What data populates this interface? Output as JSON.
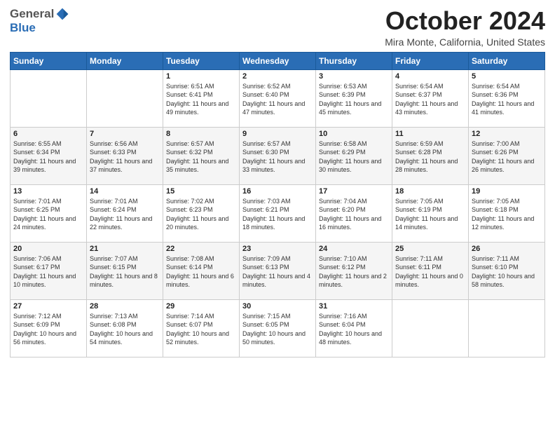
{
  "logo": {
    "general": "General",
    "blue": "Blue"
  },
  "header": {
    "month": "October 2024",
    "location": "Mira Monte, California, United States"
  },
  "weekdays": [
    "Sunday",
    "Monday",
    "Tuesday",
    "Wednesday",
    "Thursday",
    "Friday",
    "Saturday"
  ],
  "weeks": [
    [
      {
        "day": "",
        "sunrise": "",
        "sunset": "",
        "daylight": ""
      },
      {
        "day": "",
        "sunrise": "",
        "sunset": "",
        "daylight": ""
      },
      {
        "day": "1",
        "sunrise": "Sunrise: 6:51 AM",
        "sunset": "Sunset: 6:41 PM",
        "daylight": "Daylight: 11 hours and 49 minutes."
      },
      {
        "day": "2",
        "sunrise": "Sunrise: 6:52 AM",
        "sunset": "Sunset: 6:40 PM",
        "daylight": "Daylight: 11 hours and 47 minutes."
      },
      {
        "day": "3",
        "sunrise": "Sunrise: 6:53 AM",
        "sunset": "Sunset: 6:39 PM",
        "daylight": "Daylight: 11 hours and 45 minutes."
      },
      {
        "day": "4",
        "sunrise": "Sunrise: 6:54 AM",
        "sunset": "Sunset: 6:37 PM",
        "daylight": "Daylight: 11 hours and 43 minutes."
      },
      {
        "day": "5",
        "sunrise": "Sunrise: 6:54 AM",
        "sunset": "Sunset: 6:36 PM",
        "daylight": "Daylight: 11 hours and 41 minutes."
      }
    ],
    [
      {
        "day": "6",
        "sunrise": "Sunrise: 6:55 AM",
        "sunset": "Sunset: 6:34 PM",
        "daylight": "Daylight: 11 hours and 39 minutes."
      },
      {
        "day": "7",
        "sunrise": "Sunrise: 6:56 AM",
        "sunset": "Sunset: 6:33 PM",
        "daylight": "Daylight: 11 hours and 37 minutes."
      },
      {
        "day": "8",
        "sunrise": "Sunrise: 6:57 AM",
        "sunset": "Sunset: 6:32 PM",
        "daylight": "Daylight: 11 hours and 35 minutes."
      },
      {
        "day": "9",
        "sunrise": "Sunrise: 6:57 AM",
        "sunset": "Sunset: 6:30 PM",
        "daylight": "Daylight: 11 hours and 33 minutes."
      },
      {
        "day": "10",
        "sunrise": "Sunrise: 6:58 AM",
        "sunset": "Sunset: 6:29 PM",
        "daylight": "Daylight: 11 hours and 30 minutes."
      },
      {
        "day": "11",
        "sunrise": "Sunrise: 6:59 AM",
        "sunset": "Sunset: 6:28 PM",
        "daylight": "Daylight: 11 hours and 28 minutes."
      },
      {
        "day": "12",
        "sunrise": "Sunrise: 7:00 AM",
        "sunset": "Sunset: 6:26 PM",
        "daylight": "Daylight: 11 hours and 26 minutes."
      }
    ],
    [
      {
        "day": "13",
        "sunrise": "Sunrise: 7:01 AM",
        "sunset": "Sunset: 6:25 PM",
        "daylight": "Daylight: 11 hours and 24 minutes."
      },
      {
        "day": "14",
        "sunrise": "Sunrise: 7:01 AM",
        "sunset": "Sunset: 6:24 PM",
        "daylight": "Daylight: 11 hours and 22 minutes."
      },
      {
        "day": "15",
        "sunrise": "Sunrise: 7:02 AM",
        "sunset": "Sunset: 6:23 PM",
        "daylight": "Daylight: 11 hours and 20 minutes."
      },
      {
        "day": "16",
        "sunrise": "Sunrise: 7:03 AM",
        "sunset": "Sunset: 6:21 PM",
        "daylight": "Daylight: 11 hours and 18 minutes."
      },
      {
        "day": "17",
        "sunrise": "Sunrise: 7:04 AM",
        "sunset": "Sunset: 6:20 PM",
        "daylight": "Daylight: 11 hours and 16 minutes."
      },
      {
        "day": "18",
        "sunrise": "Sunrise: 7:05 AM",
        "sunset": "Sunset: 6:19 PM",
        "daylight": "Daylight: 11 hours and 14 minutes."
      },
      {
        "day": "19",
        "sunrise": "Sunrise: 7:05 AM",
        "sunset": "Sunset: 6:18 PM",
        "daylight": "Daylight: 11 hours and 12 minutes."
      }
    ],
    [
      {
        "day": "20",
        "sunrise": "Sunrise: 7:06 AM",
        "sunset": "Sunset: 6:17 PM",
        "daylight": "Daylight: 11 hours and 10 minutes."
      },
      {
        "day": "21",
        "sunrise": "Sunrise: 7:07 AM",
        "sunset": "Sunset: 6:15 PM",
        "daylight": "Daylight: 11 hours and 8 minutes."
      },
      {
        "day": "22",
        "sunrise": "Sunrise: 7:08 AM",
        "sunset": "Sunset: 6:14 PM",
        "daylight": "Daylight: 11 hours and 6 minutes."
      },
      {
        "day": "23",
        "sunrise": "Sunrise: 7:09 AM",
        "sunset": "Sunset: 6:13 PM",
        "daylight": "Daylight: 11 hours and 4 minutes."
      },
      {
        "day": "24",
        "sunrise": "Sunrise: 7:10 AM",
        "sunset": "Sunset: 6:12 PM",
        "daylight": "Daylight: 11 hours and 2 minutes."
      },
      {
        "day": "25",
        "sunrise": "Sunrise: 7:11 AM",
        "sunset": "Sunset: 6:11 PM",
        "daylight": "Daylight: 11 hours and 0 minutes."
      },
      {
        "day": "26",
        "sunrise": "Sunrise: 7:11 AM",
        "sunset": "Sunset: 6:10 PM",
        "daylight": "Daylight: 10 hours and 58 minutes."
      }
    ],
    [
      {
        "day": "27",
        "sunrise": "Sunrise: 7:12 AM",
        "sunset": "Sunset: 6:09 PM",
        "daylight": "Daylight: 10 hours and 56 minutes."
      },
      {
        "day": "28",
        "sunrise": "Sunrise: 7:13 AM",
        "sunset": "Sunset: 6:08 PM",
        "daylight": "Daylight: 10 hours and 54 minutes."
      },
      {
        "day": "29",
        "sunrise": "Sunrise: 7:14 AM",
        "sunset": "Sunset: 6:07 PM",
        "daylight": "Daylight: 10 hours and 52 minutes."
      },
      {
        "day": "30",
        "sunrise": "Sunrise: 7:15 AM",
        "sunset": "Sunset: 6:05 PM",
        "daylight": "Daylight: 10 hours and 50 minutes."
      },
      {
        "day": "31",
        "sunrise": "Sunrise: 7:16 AM",
        "sunset": "Sunset: 6:04 PM",
        "daylight": "Daylight: 10 hours and 48 minutes."
      },
      {
        "day": "",
        "sunrise": "",
        "sunset": "",
        "daylight": ""
      },
      {
        "day": "",
        "sunrise": "",
        "sunset": "",
        "daylight": ""
      }
    ]
  ]
}
